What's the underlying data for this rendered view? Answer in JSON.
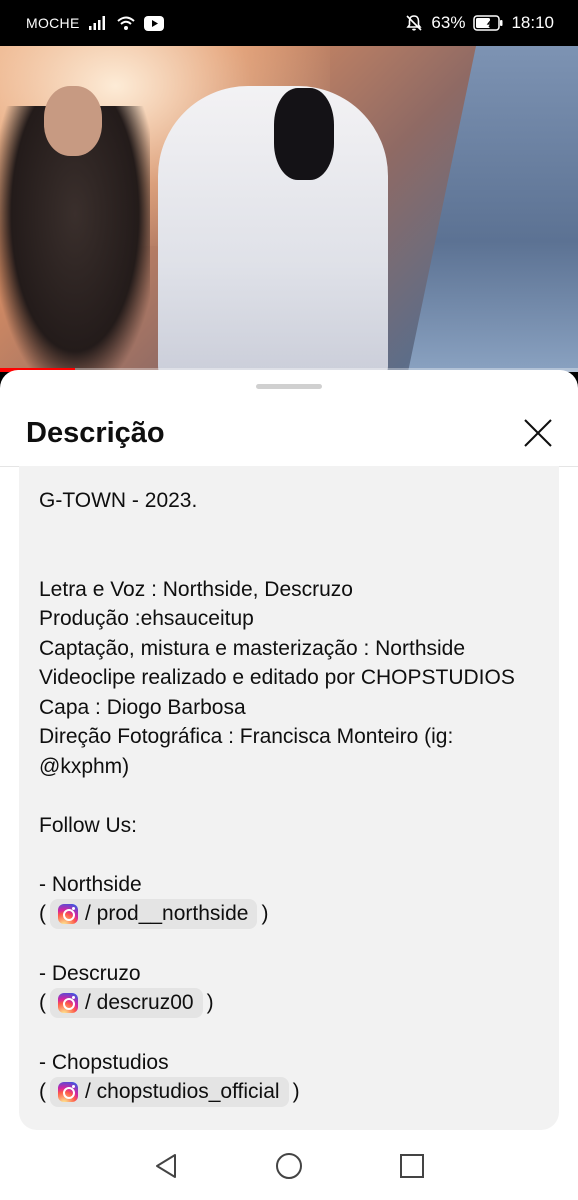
{
  "status_bar": {
    "carrier": "MOCHE",
    "battery": "63%",
    "time": "18:10",
    "icons": [
      "signal-icon",
      "wifi-icon",
      "youtube-icon",
      "mute-icon",
      "battery-icon"
    ]
  },
  "video": {
    "progress_percent": 13
  },
  "sheet": {
    "title": "Descrição",
    "description_lines": [
      "G-TOWN - 2023.",
      "",
      "",
      "Letra e Voz : Northside, Descruzo",
      "Produção :ehsauceitup",
      "Captação, mistura e masterização : Northside",
      "Videoclipe realizado e editado por CHOPSTUDIOS",
      "Capa : Diogo Barbosa",
      "Direção Fotográfica : Francisca Monteiro (ig:",
      "@kxphm)",
      "",
      "Follow Us:",
      ""
    ],
    "links": [
      {
        "name": "- Northside",
        "open": "(",
        "handle": "/ prod__northside",
        "close": ")"
      },
      {
        "name": "- Descruzo",
        "open": "(",
        "handle": "/ descruz00",
        "close": ")"
      },
      {
        "name": "- Chopstudios",
        "open": "(",
        "handle": "/ chopstudios_official",
        "close": ")"
      }
    ]
  },
  "colors": {
    "accent": "#ff0000",
    "card_bg": "#f2f2f2",
    "chip_bg": "#e4e4e4"
  }
}
